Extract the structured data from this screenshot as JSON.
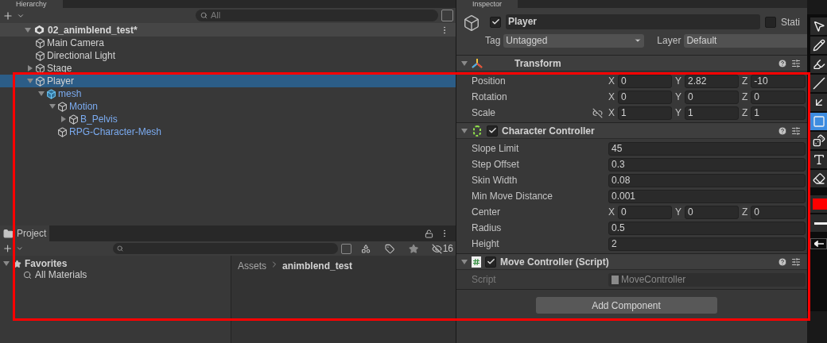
{
  "hierarchy": {
    "tab": "Hierarchy",
    "search_placeholder": "All",
    "scene": {
      "name": "02_animblend_test*",
      "expanded": true
    },
    "tree": [
      {
        "name": "Main Camera",
        "kind": "object",
        "selected": false
      },
      {
        "name": "Directional Light",
        "kind": "object",
        "selected": false
      },
      {
        "name": "Stage",
        "kind": "object",
        "selected": false,
        "expanded": false
      },
      {
        "name": "Player",
        "kind": "object",
        "selected": true,
        "expanded": true,
        "children": [
          {
            "name": "mesh",
            "kind": "prefab",
            "selected": false,
            "expanded": true,
            "children": [
              {
                "name": "Motion",
                "kind": "prefab_part",
                "selected": false,
                "expanded": true,
                "children": [
                  {
                    "name": "B_Pelvis",
                    "kind": "prefab_part",
                    "selected": false,
                    "expanded": false
                  }
                ]
              },
              {
                "name": "RPG-Character-Mesh",
                "kind": "prefab_part",
                "selected": false
              }
            ]
          }
        ]
      }
    ]
  },
  "project": {
    "tab": "Project",
    "hidden_count": "16",
    "favorites": {
      "label": "Favorites",
      "expanded": true,
      "items": [
        "All Materials"
      ]
    },
    "breadcrumb": [
      "Assets",
      "animblend_test"
    ]
  },
  "inspector": {
    "tab": "Inspector",
    "object": {
      "active": true,
      "name": "Player",
      "static": false,
      "static_label": "Stati",
      "tag_label": "Tag",
      "tag": "Untagged",
      "layer_label": "Layer",
      "layer": "Default"
    },
    "components": [
      {
        "title": "Transform",
        "kind": "transform",
        "expanded": true,
        "rows": [
          {
            "label": "Position",
            "kind": "vector",
            "values": [
              {
                "axis": "X",
                "value": "0"
              },
              {
                "axis": "Y",
                "value": "2.82"
              },
              {
                "axis": "Z",
                "value": "-10"
              }
            ]
          },
          {
            "label": "Rotation",
            "kind": "vector",
            "values": [
              {
                "axis": "X",
                "value": "0"
              },
              {
                "axis": "Y",
                "value": "0"
              },
              {
                "axis": "Z",
                "value": "0"
              }
            ]
          },
          {
            "label": "Scale",
            "kind": "vector",
            "constrained": false,
            "values": [
              {
                "axis": "X",
                "value": "1"
              },
              {
                "axis": "Y",
                "value": "1"
              },
              {
                "axis": "Z",
                "value": "1"
              }
            ]
          }
        ]
      },
      {
        "title": "Character Controller",
        "kind": "collider",
        "expanded": true,
        "enabled": true,
        "rows": [
          {
            "label": "Slope Limit",
            "kind": "number",
            "value": "45"
          },
          {
            "label": "Step Offset",
            "kind": "number",
            "value": "0.3"
          },
          {
            "label": "Skin Width",
            "kind": "number",
            "value": "0.08"
          },
          {
            "label": "Min Move Distance",
            "kind": "number",
            "value": "0.001"
          },
          {
            "label": "Center",
            "kind": "vector",
            "values": [
              {
                "axis": "X",
                "value": "0"
              },
              {
                "axis": "Y",
                "value": "0"
              },
              {
                "axis": "Z",
                "value": "0"
              }
            ]
          },
          {
            "label": "Radius",
            "kind": "number",
            "value": "0.5"
          },
          {
            "label": "Height",
            "kind": "number",
            "value": "2"
          }
        ]
      },
      {
        "title": "Move Controller (Script)",
        "kind": "script",
        "expanded": true,
        "enabled": true,
        "rows": [
          {
            "label": "Script",
            "kind": "object_ref",
            "value": "MoveController",
            "disabled": true
          }
        ]
      }
    ],
    "add_button": "Add Component"
  },
  "palette": {
    "tools": [
      {
        "kind": "pointer",
        "selected": false
      },
      {
        "kind": "pencil",
        "selected": false
      },
      {
        "kind": "marker",
        "selected": false
      },
      {
        "kind": "line",
        "selected": false
      },
      {
        "kind": "arrow",
        "selected": false
      },
      {
        "kind": "rectangle",
        "selected": true
      },
      {
        "kind": "stamp",
        "selected": false
      },
      {
        "kind": "text",
        "selected": false
      },
      {
        "kind": "eraser",
        "selected": false
      }
    ],
    "color": "#ff0000"
  }
}
